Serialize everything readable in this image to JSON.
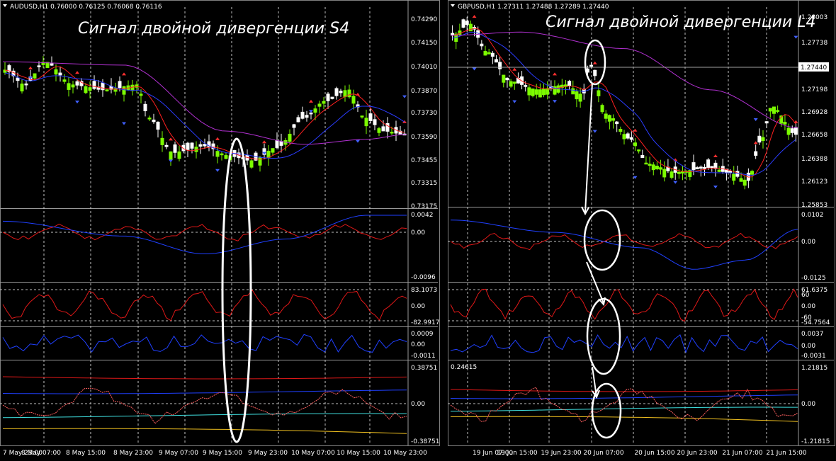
{
  "colors": {
    "background": "#000000",
    "candle_up": "#7CFC00",
    "candle_down": "#ffffff",
    "ma_fast": "#ff2020",
    "ma_mid": "#2b3cff",
    "ma_slow": "#b030d0",
    "osc_red": "#e01818",
    "osc_blue": "#2040ff",
    "band_cyan": "#40e0e0",
    "band_yellow": "#f0c020",
    "arrow_up": "#4060ff",
    "arrow_down": "#ff3030",
    "grid": "#c0c0c0"
  },
  "icons": {
    "symbol_menu": "triangle-down-icon"
  },
  "left": {
    "header": "AUDUSD,H1  0.76000 0.76125 0.76068 0.76116",
    "title": "Сигнал двойной дивергенции S4",
    "price_ticks": [
      "0.74290",
      "0.74150",
      "0.74010",
      "0.73870",
      "0.73730",
      "0.73590",
      "0.73455",
      "0.73315",
      "0.73175"
    ],
    "panel1_ticks": [
      "0.0042",
      "0.00",
      "-0.0096"
    ],
    "panel2_ticks": [
      "83.1073",
      "0.00",
      "-82.9917"
    ],
    "panel3_ticks": [
      "0.0009",
      "0.00",
      "-0.0011"
    ],
    "panel4_ticks": [
      "0.38751",
      "0.00",
      "-0.38751"
    ],
    "time_labels": [
      "7 May 23:00",
      "8 May 07:00",
      "8 May 15:00",
      "8 May 23:00",
      "9 May 07:00",
      "9 May 15:00",
      "9 May 23:00",
      "10 May 07:00",
      "10 May 15:00",
      "10 May 23:00"
    ]
  },
  "right": {
    "header": "GBPUSD,H1  1.27311 1.27488 1.27289 1.27440",
    "title": "Сигнал двойной дивергенции L4",
    "price_ticks": [
      "1.28003",
      "1.27738",
      "1.27440",
      "1.27198",
      "1.26928",
      "1.26658",
      "1.26388",
      "1.26123",
      "1.25853"
    ],
    "current_price": "1.27440",
    "panel1_ticks": [
      "0.0102",
      "0.00",
      "-0.0125"
    ],
    "panel2_ticks": [
      "61.6375",
      "60",
      "0.00",
      "-60",
      "-54.7564"
    ],
    "panel3_ticks": [
      "0.0037",
      "0.00",
      "-0.0031"
    ],
    "panel4_ticks": [
      "1.21815",
      "0.00",
      "-1.21815"
    ],
    "panel4_left_value": "0.24615",
    "time_labels": [
      "19 Jun 07:00",
      "19 Jun 15:00",
      "19 Jun 23:00",
      "20 Jun 07:00",
      "20 Jun 15:00",
      "20 Jun 23:00",
      "21 Jun 07:00",
      "21 Jun 15:00"
    ]
  }
}
